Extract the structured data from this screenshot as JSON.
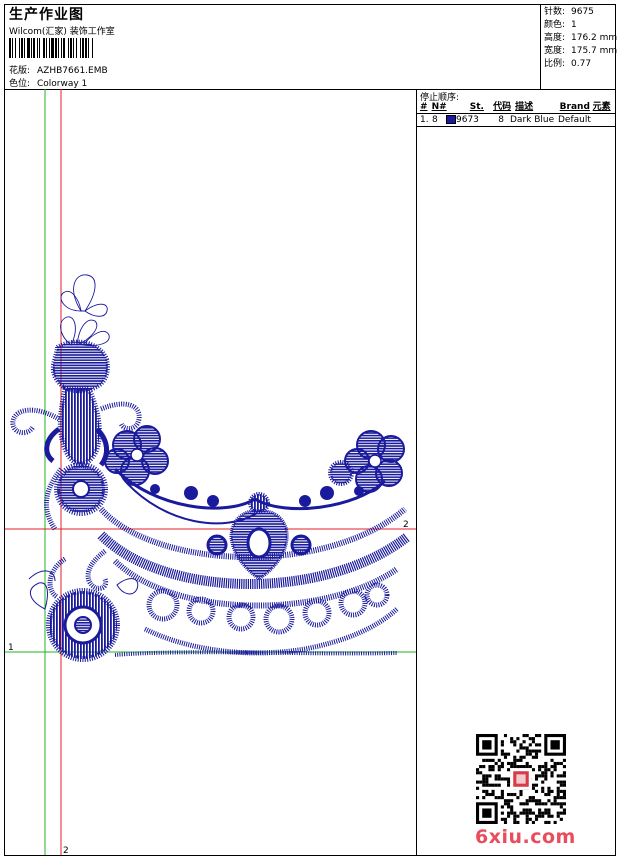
{
  "header": {
    "title": "生产作业图",
    "subtitle": "Wilcom(汇家) 装饰工作室",
    "design_label": "花版:",
    "design_value": "AZHB7661.EMB",
    "colorway_label": "色位:",
    "colorway_value": "Colorway 1"
  },
  "stats": [
    {
      "label": "针数:",
      "value": "9675"
    },
    {
      "label": "颜色:",
      "value": "1"
    },
    {
      "label": "高度:",
      "value": "176.2 mm"
    },
    {
      "label": "宽度:",
      "value": "175.7 mm"
    },
    {
      "label": "比例:",
      "value": "0.77"
    }
  ],
  "stop_sequence": {
    "heading": "停止顺序:",
    "columns": [
      "#",
      "N#",
      "St.",
      "代码",
      "描述",
      "Brand",
      "元素"
    ],
    "rows": [
      {
        "num": "1.",
        "n": "8",
        "swatch_color": "#1a1a9c",
        "stitches": "9673",
        "code": "8",
        "desc": "Dark Blue",
        "brand": "Default",
        "element": ""
      }
    ]
  },
  "guides": {
    "green_vertical_label": "1",
    "red_vertical_label": "2",
    "red_horizontal_label": "2",
    "green_horizontal_label": "1"
  },
  "colors": {
    "thread": "#1a1a9c",
    "guide_red": "#e0202a",
    "guide_green": "#22b522",
    "watermark": "#e94d5c"
  },
  "watermark": "6xiu.com"
}
